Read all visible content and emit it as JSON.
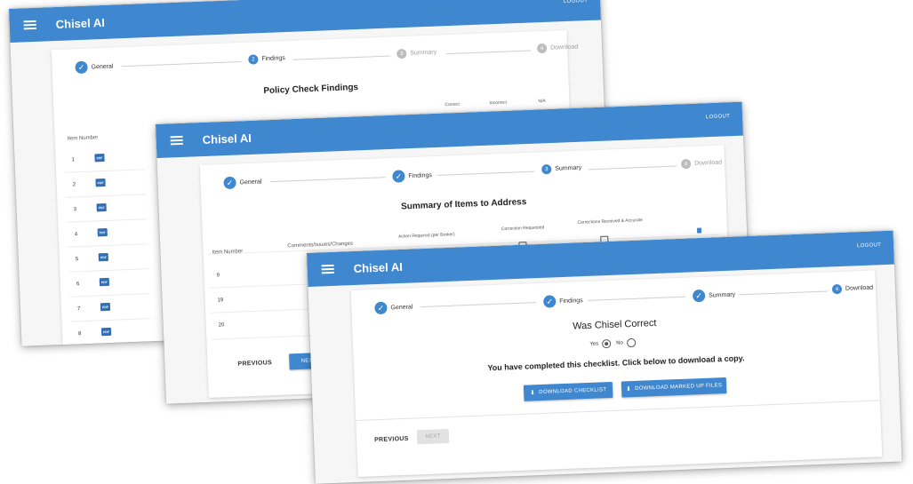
{
  "app": {
    "title": "Chisel AI",
    "logout": "LOGOUT"
  },
  "colors": {
    "accent": "#3f87ce",
    "background": "#f6f6f6",
    "disabled": "#e2e2e2"
  },
  "steps": {
    "general": "General",
    "findings": "Findings",
    "summary": "Summary",
    "download": "Download",
    "n2": "2",
    "n3": "3",
    "n4": "4",
    "check": "✓"
  },
  "findings_screen": {
    "title": "Policy Check Findings",
    "headers": {
      "item_number": "Item Number",
      "correct": "Correct",
      "incorrect": "Incorrect",
      "na": "N/A"
    },
    "rows": [
      "1",
      "2",
      "3",
      "4",
      "5",
      "6",
      "7",
      "8"
    ],
    "pdf_label": "PDF"
  },
  "summary_screen": {
    "title": "Summary of Items to Address",
    "headers": {
      "item_number": "Item Number",
      "comments": "Comments/Issues/Changes",
      "action": "Action Required (per Broker)",
      "correction": "Correction Requested",
      "received": "Corrections Received & Accurate"
    },
    "rows": [
      "9",
      "19",
      "20"
    ],
    "previous": "PREVIOUS",
    "next": "NEXT"
  },
  "download_screen": {
    "question": "Was Chisel Correct",
    "yes": "Yes",
    "no": "No",
    "completed": "You have completed this checklist. Click below to download a copy.",
    "download_checklist": "DOWNLOAD CHECKLIST",
    "download_marked": "DOWNLOAD MARKED UP FILES",
    "previous": "PREVIOUS",
    "next": "NEXT"
  }
}
